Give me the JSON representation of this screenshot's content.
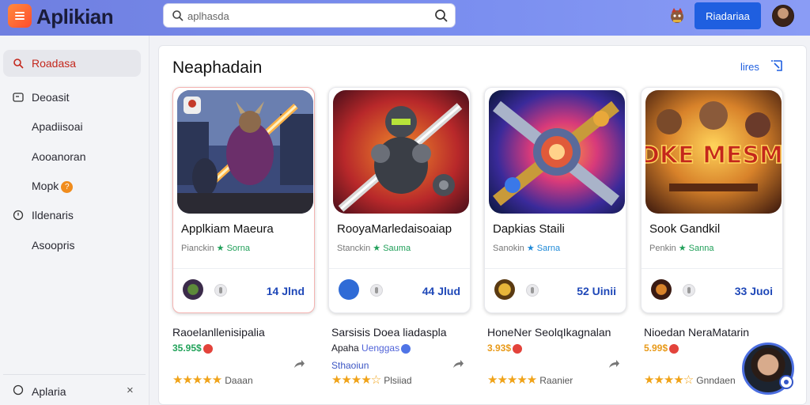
{
  "app": {
    "brand": "Aplikian"
  },
  "header": {
    "search_placeholder": "aplhasda",
    "primary_button": "Riadariaa"
  },
  "sidebar": {
    "items": [
      {
        "label": "Roadasa",
        "icon": "search-icon",
        "active": true
      },
      {
        "label": "Deoasit",
        "icon": "folder-icon"
      },
      {
        "label": "Apadiisoai"
      },
      {
        "label": "Aooanoran"
      },
      {
        "label": "Mopk",
        "badge": "?"
      },
      {
        "label": "Ildenaris",
        "icon": "clock-icon"
      },
      {
        "label": "Asoopris"
      }
    ],
    "footer": {
      "label": "Aplaria",
      "icon": "circle-icon",
      "close": "×"
    }
  },
  "main": {
    "title": "Neaphadain",
    "more_link": "lires",
    "cards": [
      {
        "name": "Applkiam Maeura",
        "meta_prefix": "Pianckin",
        "rating": "Sorna",
        "price": "14 Jlnd",
        "rating_color": "green"
      },
      {
        "name": "RooyaMarledaisoaiap",
        "meta_prefix": "Stanckin",
        "rating": "Sauma",
        "price": "44 Jlud",
        "rating_color": "green"
      },
      {
        "name": "Dapkias Staili",
        "meta_prefix": "Sanokin",
        "rating": "Sarna",
        "price": "52 Uinii",
        "rating_color": "blue"
      },
      {
        "name": "Sook Gandkil",
        "meta_prefix": "Penkin",
        "rating": "Sanna",
        "price": "33 Juoi",
        "rating_color": "green"
      }
    ],
    "list": [
      {
        "title": "Raoelanllenisipalia",
        "price": "35.95$",
        "sub2": "",
        "stars": "★★★★★",
        "stars_label": "Daaan"
      },
      {
        "title": "Sarsisis Doea liadaspla",
        "extra": "Apaha",
        "chip": "Uenggas",
        "sub2": "Sthaoiun",
        "stars": "★★★★☆",
        "stars_label": "Plsiiad"
      },
      {
        "title": "HoneNer SeolqIkagnalan",
        "price": "3.93$",
        "sub2": "",
        "stars": "★★★★★",
        "stars_label": "Raanier"
      },
      {
        "title": "Nioedan NeraMatarin",
        "price": "5.99$",
        "sub2": "",
        "stars": "★★★★☆",
        "stars_label": "Gnndaen"
      }
    ],
    "card_art": [
      "Warrior hero game art",
      "Armored knight game art",
      "Crossed blades game art",
      "DADKE MESMEIS"
    ]
  },
  "colors": {
    "accent": "#1f5fe0",
    "topbar": "#7b8ff0",
    "star": "#f0a319",
    "green": "#21a05a"
  }
}
